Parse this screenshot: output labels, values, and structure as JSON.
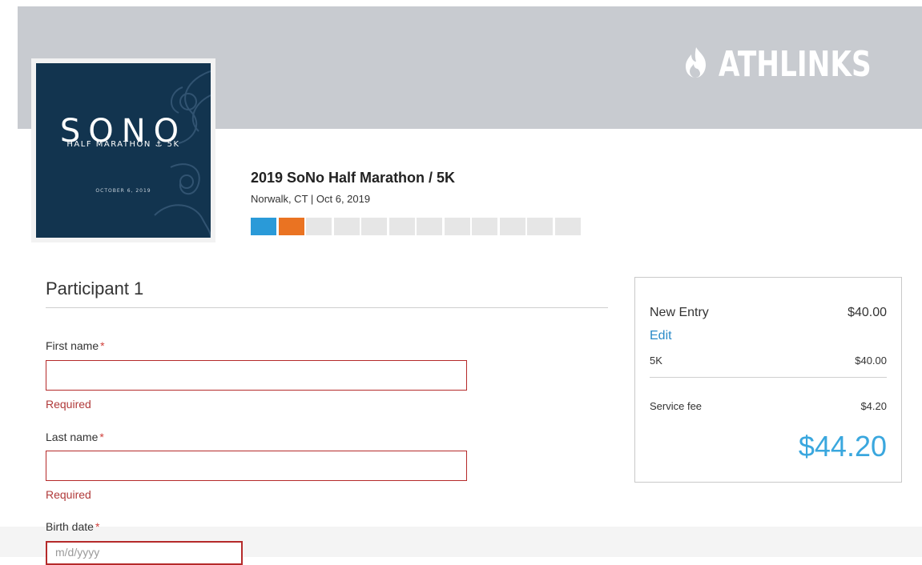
{
  "brand": {
    "name": "ATHLINKS",
    "icon": "flame-icon"
  },
  "event_logo": {
    "wordmark": "SONO",
    "subtitle": "HALF MARATHON ⚓ 5K",
    "date": "OCTOBER 6, 2019"
  },
  "event": {
    "title": "2019 SoNo Half Marathon / 5K",
    "meta": "Norwalk, CT | Oct 6, 2019"
  },
  "progress": {
    "total_steps": 12,
    "step_colors": [
      "#2a9ad8",
      "#ea7322"
    ]
  },
  "form": {
    "section_title": "Participant 1",
    "first_name_label": "First name",
    "last_name_label": "Last name",
    "birth_date_label": "Birth date",
    "required_mark": "*",
    "first_name_error": "Required",
    "last_name_error": "Required",
    "first_name_value": "",
    "last_name_value": "",
    "birth_date_placeholder": "m/d/yyyy"
  },
  "summary": {
    "entry_label": "New Entry",
    "entry_price": "$40.00",
    "edit_label": "Edit",
    "item_label": "5K",
    "item_price": "$40.00",
    "fee_label": "Service fee",
    "fee_price": "$4.20",
    "total": "$44.20"
  },
  "colors": {
    "accent_blue": "#2a9ad8",
    "accent_orange": "#ea7322",
    "error_red": "#b52a2a",
    "total_blue": "#3aa7de",
    "link_blue": "#2a8ac8"
  }
}
